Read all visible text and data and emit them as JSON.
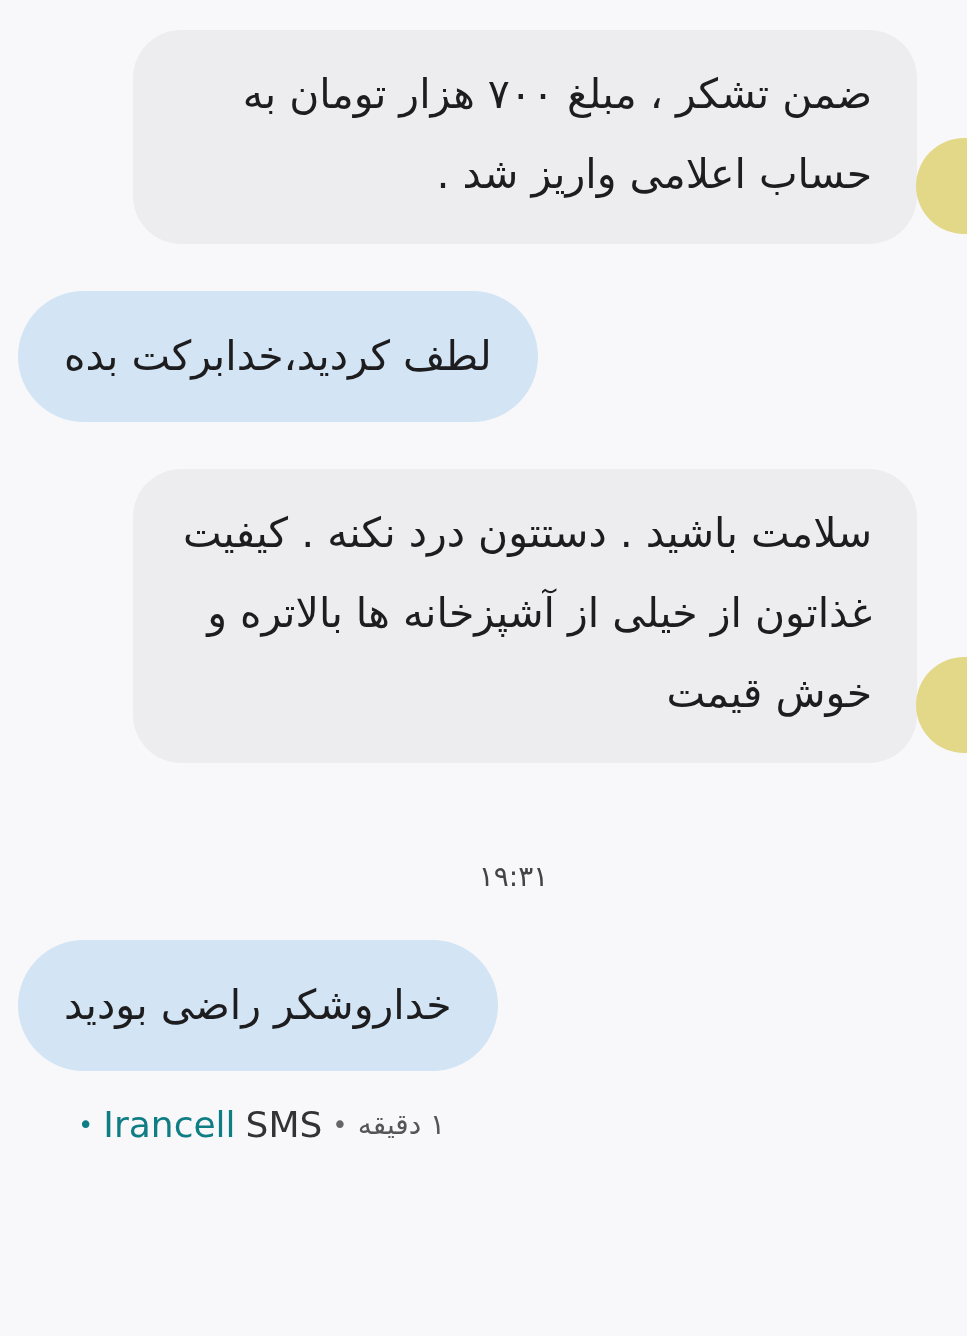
{
  "messages": [
    {
      "kind": "incoming",
      "text": "ضمن تشکر ، مبلغ ۷۰۰ هزار تومان به حساب اعلامی واریز شد ."
    },
    {
      "kind": "outgoing",
      "text": "لطف کردید،خدابرکت بده"
    },
    {
      "kind": "incoming",
      "text": "سلامت باشید . دستتون درد نکنه . کیفیت غذاتون از خیلی از آشپزخانه ها بالاتره و خوش قیمت"
    },
    {
      "kind": "time",
      "text": "۱۹:۳۱"
    },
    {
      "kind": "outgoing",
      "text": "خداروشکر راضی بودید"
    }
  ],
  "status": {
    "lead_dot": "•",
    "carrier": "Irancell",
    "sim": "SMS",
    "separator": "•",
    "age": "۱ دقیقه"
  }
}
